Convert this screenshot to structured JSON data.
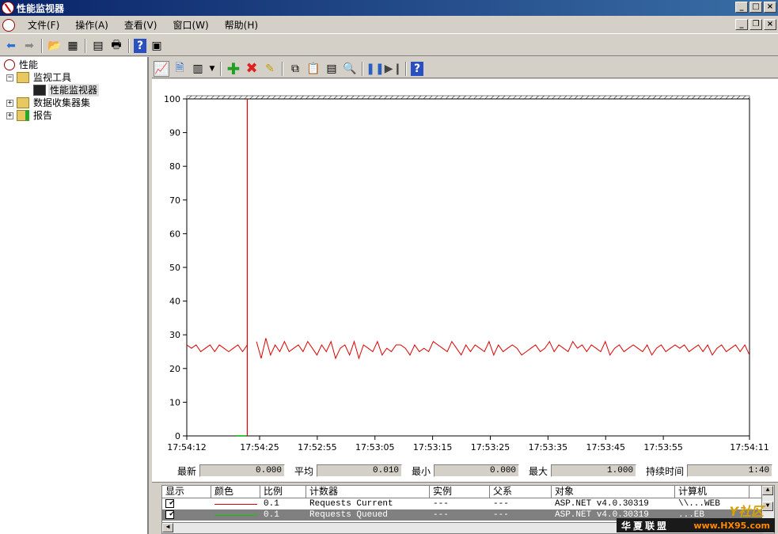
{
  "window": {
    "title": "性能监视器"
  },
  "menu": [
    "文件(F)",
    "操作(A)",
    "查看(V)",
    "窗口(W)",
    "帮助(H)"
  ],
  "tree": {
    "root": "性能",
    "monitor_tools": "监视工具",
    "perf_monitor": "性能监视器",
    "data_collector": "数据收集器集",
    "reports": "报告"
  },
  "chart_data": {
    "type": "line",
    "ylim": [
      0,
      100
    ],
    "yticks": [
      "0",
      "10",
      "20",
      "30",
      "40",
      "50",
      "60",
      "70",
      "80",
      "90",
      "100"
    ],
    "xticks": [
      "17:54:12",
      "17:54:25",
      "17:52:55",
      "17:53:05",
      "17:53:15",
      "17:53:25",
      "17:53:35",
      "17:53:45",
      "17:53:55",
      "17:54:11"
    ],
    "current_time_marker_index": 13,
    "series": [
      {
        "color": "#dd0000",
        "values": [
          27,
          26,
          27,
          25,
          26,
          27,
          25,
          27,
          26,
          25,
          26,
          27,
          25,
          27,
          null,
          28,
          23,
          29,
          24,
          27,
          25,
          28,
          25,
          26,
          27,
          25,
          28,
          26,
          24,
          27,
          25,
          28,
          23,
          26,
          27,
          24,
          28,
          23,
          27,
          26,
          25,
          28,
          24,
          26,
          25,
          27,
          27,
          26,
          24,
          27,
          25,
          26,
          25,
          28,
          27,
          26,
          25,
          28,
          26,
          24,
          27,
          25,
          27,
          26,
          25,
          28,
          24,
          27,
          25,
          26,
          27,
          26,
          24,
          25,
          26,
          27,
          25,
          26,
          28,
          25,
          27,
          26,
          25,
          28,
          26,
          27,
          25,
          27,
          26,
          25,
          28,
          24,
          26,
          27,
          25,
          26,
          27,
          26,
          25,
          27,
          24,
          26,
          27,
          25,
          26,
          27,
          26,
          27,
          25,
          26,
          27,
          25,
          27,
          24,
          26,
          27,
          25,
          26,
          27,
          25,
          27,
          24
        ]
      },
      {
        "color": "#00aa00",
        "values": [
          0
        ]
      }
    ]
  },
  "stats": {
    "last_label": "最新",
    "last_value": "0.000",
    "avg_label": "平均",
    "avg_value": "0.010",
    "min_label": "最小",
    "min_value": "0.000",
    "max_label": "最大",
    "max_value": "1.000",
    "duration_label": "持续时间",
    "duration_value": "1:40"
  },
  "legend": {
    "headers": [
      "显示",
      "颜色",
      "比例",
      "计数器",
      "实例",
      "父系",
      "对象",
      "计算机"
    ],
    "rows": [
      {
        "scale": "0.1",
        "counter": "Requests Current",
        "instance": "---",
        "parent": "---",
        "object": "ASP.NET v4.0.30319",
        "computer": "\\\\...WEB",
        "color": "#dd0000"
      },
      {
        "scale": "0.1",
        "counter": "Requests Queued",
        "instance": "---",
        "parent": "---",
        "object": "ASP.NET v4.0.30319",
        "computer": "...EB",
        "color": "#00aa00"
      }
    ]
  },
  "watermark": {
    "text": "华夏联盟",
    "site": "www.HX95.com",
    "logo": "Y社区"
  }
}
